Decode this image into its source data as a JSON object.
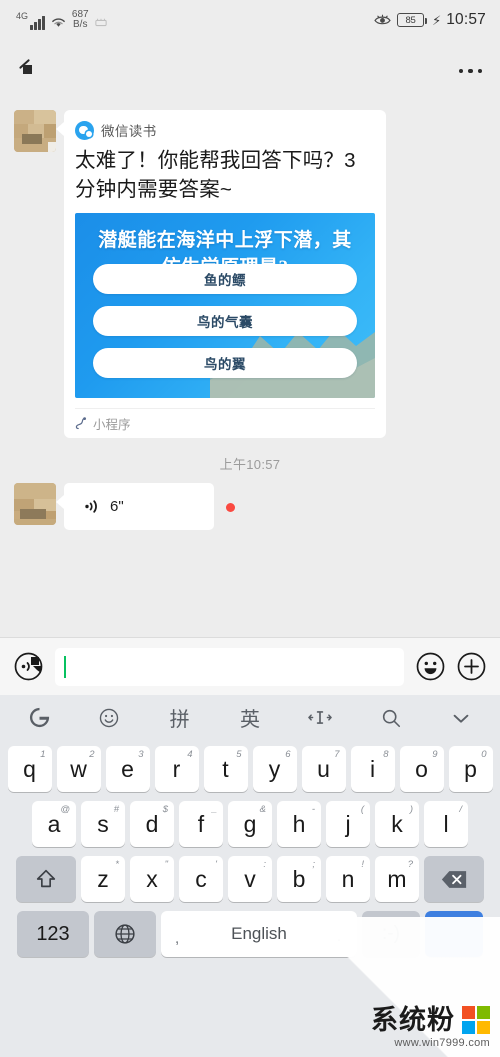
{
  "statusbar": {
    "network_type": "4G",
    "data_speed": "687",
    "data_speed_unit": "B/s",
    "battery_level": "85",
    "time": "10:57",
    "icons": [
      "signal-bars-icon",
      "wifi-icon",
      "alarm-icon",
      "eye-comfort-icon",
      "battery-icon",
      "charging-bolt-icon"
    ]
  },
  "navbar": {
    "title_censored": "",
    "more_label": "",
    "back_icon": "back-arrow-icon"
  },
  "chat": {
    "messages": [
      {
        "type": "miniprogram-card",
        "source": "微信读书",
        "title": "太难了！你能帮我回答下吗？3分钟内需要答案~",
        "question": "潜艇能在海洋中上浮下潜，其仿生学原理是?",
        "options": [
          "鱼的鳔",
          "鸟的气囊",
          "鸟的翼"
        ],
        "footer": "小程序"
      }
    ],
    "timestamp": "上午10:57",
    "voice_message": {
      "duration": "6\"",
      "unread": true
    }
  },
  "inputbar": {
    "voice_button": "voice-input-button",
    "text_value": "",
    "placeholder": "",
    "emoji_button": "emoji-button",
    "plus_button": "more-button"
  },
  "keyboard": {
    "toolbar": [
      {
        "name": "gboard-logo-icon",
        "label": "G"
      },
      {
        "name": "emoji-icon",
        "label": "☺"
      },
      {
        "name": "pinyin-mode-icon",
        "label": "拼"
      },
      {
        "name": "english-mode-icon",
        "label": "英"
      },
      {
        "name": "cursor-move-icon",
        "label": "⁘"
      },
      {
        "name": "search-icon",
        "label": "⌕"
      },
      {
        "name": "collapse-keyboard-icon",
        "label": "⌄"
      }
    ],
    "row1": [
      {
        "key": "q",
        "sup": "1"
      },
      {
        "key": "w",
        "sup": "2"
      },
      {
        "key": "e",
        "sup": "3"
      },
      {
        "key": "r",
        "sup": "4"
      },
      {
        "key": "t",
        "sup": "5"
      },
      {
        "key": "y",
        "sup": "6"
      },
      {
        "key": "u",
        "sup": "7"
      },
      {
        "key": "i",
        "sup": "8"
      },
      {
        "key": "o",
        "sup": "9"
      },
      {
        "key": "p",
        "sup": "0"
      }
    ],
    "row2": [
      {
        "key": "a",
        "sup": "@"
      },
      {
        "key": "s",
        "sup": "#"
      },
      {
        "key": "d",
        "sup": "$"
      },
      {
        "key": "f",
        "sup": "_"
      },
      {
        "key": "g",
        "sup": "&"
      },
      {
        "key": "h",
        "sup": "-"
      },
      {
        "key": "j",
        "sup": "("
      },
      {
        "key": "k",
        "sup": ")"
      },
      {
        "key": "l",
        "sup": "/"
      }
    ],
    "row3": [
      {
        "key": "z",
        "sup": "*"
      },
      {
        "key": "x",
        "sup": "\""
      },
      {
        "key": "c",
        "sup": "'"
      },
      {
        "key": "v",
        "sup": ":"
      },
      {
        "key": "b",
        "sup": ";"
      },
      {
        "key": "n",
        "sup": "!"
      },
      {
        "key": "m",
        "sup": "?"
      }
    ],
    "shift_label": "",
    "backspace_label": "",
    "num_label": "123",
    "globe_label": "",
    "space_label": "English",
    "space_left": ",",
    "space_right": ".",
    "smiley_label": ":-)",
    "enter_label": ""
  },
  "watermark": {
    "brand": "系统粉",
    "url": "www.win7999.com"
  },
  "colors": {
    "accent_green": "#07c160",
    "card_blue": "#1f9bef",
    "unread_red": "#fa4a41",
    "page_bg": "#ededed",
    "keyboard_bg": "#e7e9ec",
    "enter_blue": "#3e7fe0"
  }
}
